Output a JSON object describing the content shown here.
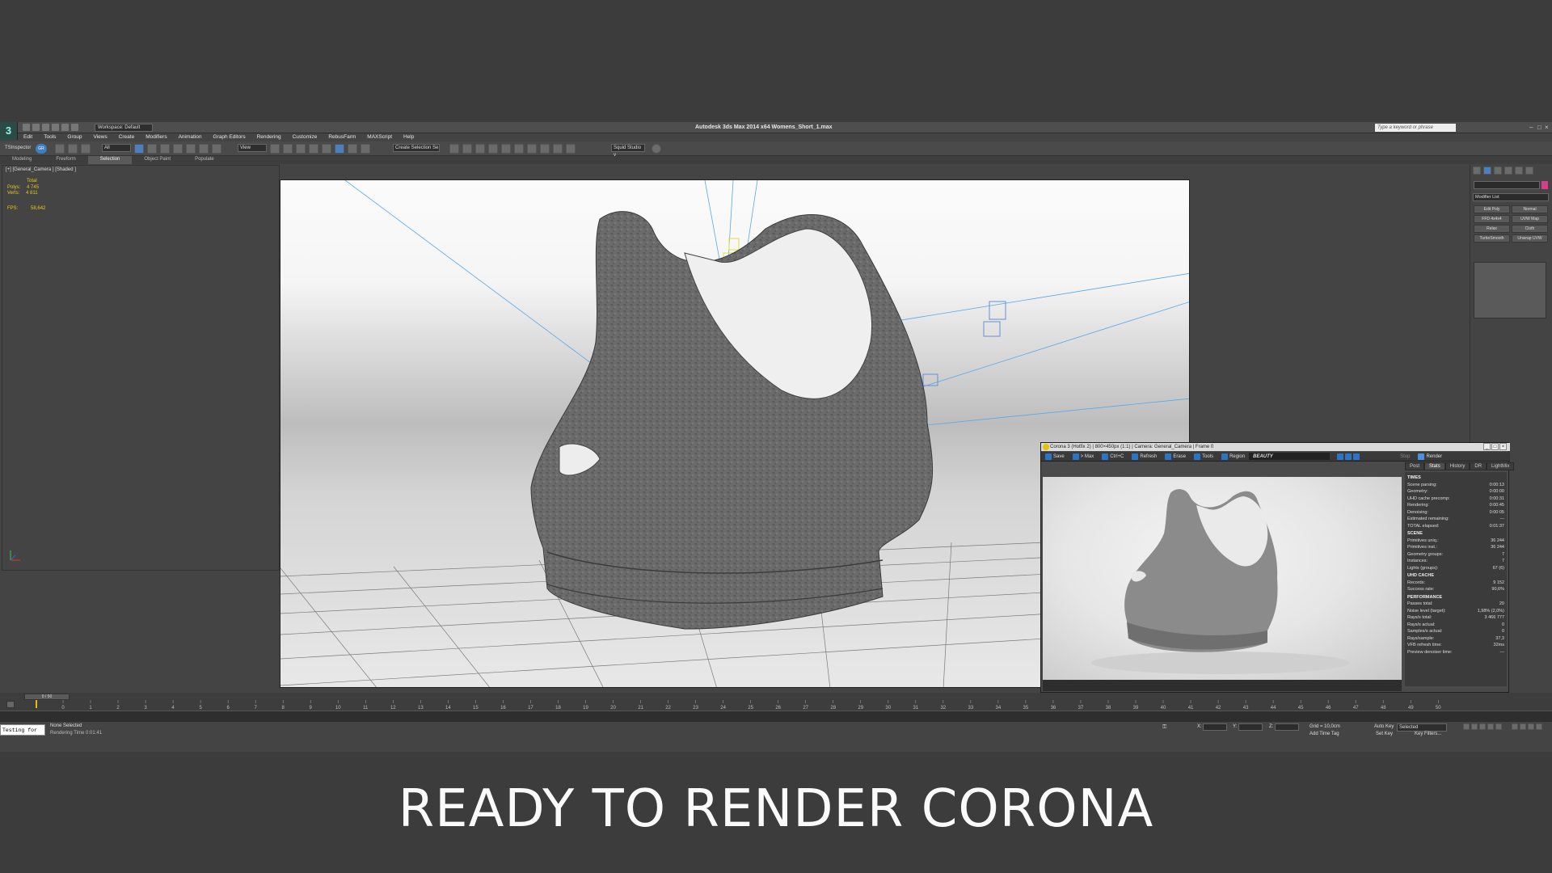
{
  "app": {
    "title": "Autodesk 3ds Max  2014 x64     Womens_Short_1.max",
    "workspace": "Workspace: Default",
    "search_placeholder": "Type a keyword or phrase"
  },
  "menu": [
    "Edit",
    "Tools",
    "Group",
    "Views",
    "Create",
    "Modifiers",
    "Animation",
    "Graph Editors",
    "Rendering",
    "Customize",
    "RebusFarm",
    "MAXScript",
    "Help"
  ],
  "toolbar": {
    "ts_label": "TSInspector",
    "ts_icon": "GR",
    "filter": "All",
    "view": "View",
    "selection_set": "Create Selection Se",
    "squid": "Squid Studio v"
  },
  "ribbon_tabs": [
    "Modeling",
    "Freeform",
    "Selection",
    "Object Paint",
    "Populate"
  ],
  "left_viewport": {
    "label": "[+] [General_Camera ] [Shaded ]",
    "stats_total": "Total",
    "polys_label": "Polys:",
    "polys_value": "4 745",
    "verts_label": "Verts:",
    "verts_value": "4 811",
    "fps_label": "FPS:",
    "fps_value": "58,642"
  },
  "modifier_panel": {
    "list_label": "Modifier List",
    "buttons": [
      "Edit Poly",
      "Normal",
      "FFD 4x4x4",
      "UVW Map",
      "Relax",
      "Cloth",
      "TurboSmooth",
      "Unwrap UVW"
    ]
  },
  "corona": {
    "title": "Corona 3 (Hotfix 2) | 800×450px (1:1) | Camera: General_Camera | Frame 0",
    "toolbar": [
      "Save",
      "> Max",
      "Ctrl+C",
      "Refresh",
      "Erase",
      "Tools",
      "Region"
    ],
    "pass": "BEAUTY",
    "stop": "Stop",
    "render": "Render",
    "tabs": [
      "Post",
      "Stats",
      "History",
      "DR",
      "LightMix"
    ],
    "sections": [
      {
        "title": "TIMES",
        "rows": [
          [
            "Scene parsing:",
            "0:00:13"
          ],
          [
            "Geometry:",
            "0:00:00"
          ],
          [
            "UHD cache precomp:",
            "0:00:31"
          ],
          [
            "Rendering:",
            "0:00:45"
          ],
          [
            "Denoising:",
            "0:00:05"
          ],
          [
            "Estimated remaining:",
            "---"
          ],
          [
            "TOTAL elapsed:",
            "0:01:37"
          ]
        ]
      },
      {
        "title": "SCENE",
        "rows": [
          [
            "Primitives uniq.:",
            "36 244"
          ],
          [
            "Primitives inst.:",
            "36 244"
          ],
          [
            "Geometry groups:",
            "7"
          ],
          [
            "Instances:",
            "7"
          ],
          [
            "Lights (groups):",
            "67 (6)"
          ]
        ]
      },
      {
        "title": "UHD CACHE",
        "rows": [
          [
            "Records:",
            "9 152"
          ],
          [
            "Success rate:",
            "90,6%"
          ]
        ]
      },
      {
        "title": "PERFORMANCE",
        "rows": [
          [
            "Passes total:",
            "20"
          ],
          [
            "Noise level (target):",
            "1,98% (2,0%)"
          ],
          [
            "Rays/s total:",
            "3 466 777"
          ],
          [
            "Rays/s actual:",
            "0"
          ],
          [
            "Samples/s actual:",
            "0"
          ],
          [
            "Rays/sample:",
            "37,3"
          ],
          [
            "VFB refresh time:",
            "32ms"
          ],
          [
            "Preview denoiser time:",
            "---"
          ]
        ]
      }
    ]
  },
  "timeline": {
    "frame": "0 / 50",
    "ticks": [
      "0",
      "1",
      "2",
      "3",
      "4",
      "5",
      "6",
      "7",
      "8",
      "9",
      "10",
      "11",
      "12",
      "13",
      "14",
      "15",
      "16",
      "17",
      "18",
      "19",
      "20",
      "21",
      "22",
      "23",
      "24",
      "25",
      "26",
      "27",
      "28",
      "29",
      "30",
      "31",
      "32",
      "33",
      "34",
      "35",
      "36",
      "37",
      "38",
      "39",
      "40",
      "41",
      "42",
      "43",
      "44",
      "45",
      "46",
      "47",
      "48",
      "49",
      "50"
    ]
  },
  "status": {
    "listener": "Testing for",
    "line1": "None Selected",
    "line2": "Rendering Time  0:01:41",
    "x": "X:",
    "y": "Y:",
    "z": "Z:",
    "grid": "Grid = 10,0cm",
    "add_time_tag": "Add Time Tag",
    "auto_key": "Auto Key",
    "selected": "Selected",
    "set_key": "Set Key",
    "key_filters": "Key Filters..."
  },
  "caption": "READY TO RENDER CORONA",
  "colors": {
    "accent": "#2e74c6",
    "stats": "#e7c81d",
    "background": "#3c3c3c"
  }
}
